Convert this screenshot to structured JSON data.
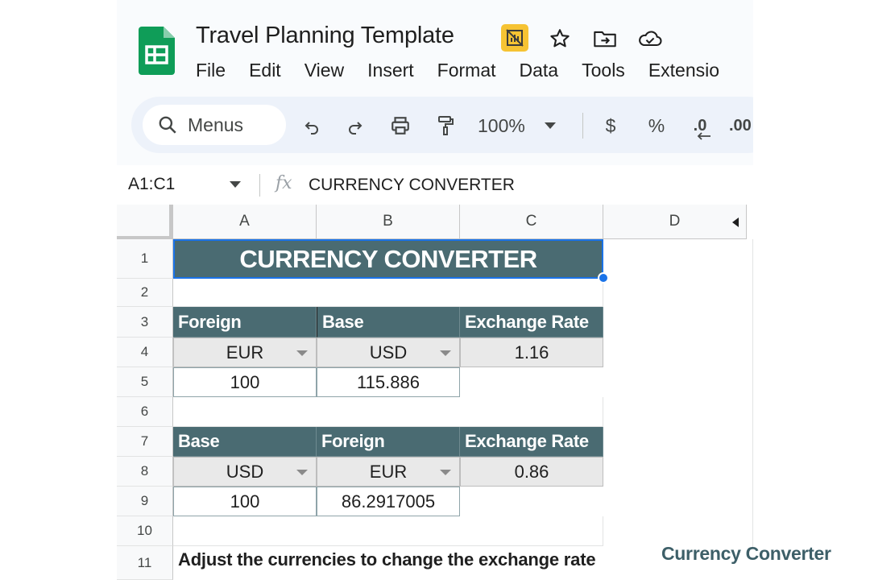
{
  "window": {
    "doc_title": "Travel Planning Template",
    "menu": [
      "File",
      "Edit",
      "View",
      "Insert",
      "Format",
      "Data",
      "Tools",
      "Extensio"
    ]
  },
  "toolbar": {
    "search_label": "Menus",
    "zoom": "100%",
    "currency_symbol": "$",
    "percent_symbol": "%",
    "decrease_decimal": ".0",
    "increase_decimal": ".00"
  },
  "formula_bar": {
    "name_box": "A1:C1",
    "fx": "fx",
    "content": "CURRENCY CONVERTER"
  },
  "columns": [
    "A",
    "B",
    "C",
    "D"
  ],
  "rows": [
    "1",
    "2",
    "3",
    "4",
    "5",
    "6",
    "7",
    "8",
    "9",
    "10",
    "11"
  ],
  "sheet": {
    "title": "CURRENCY CONVERTER",
    "table1": {
      "headers": [
        "Foreign",
        "Base",
        "Exchange Rate"
      ],
      "foreign_currency": "EUR",
      "base_currency": "USD",
      "rate": "1.16",
      "amount": "100",
      "converted": "115.886"
    },
    "table2": {
      "headers": [
        "Base",
        "Foreign",
        "Exchange Rate"
      ],
      "base_currency": "USD",
      "foreign_currency": "EUR",
      "rate": "0.86",
      "amount": "100",
      "converted": "86.2917005"
    },
    "note": "Adjust the currencies to change the exchange rate"
  },
  "overlay_caption": "Currency Converter",
  "colors": {
    "header_fill": "#4a6b72",
    "selection": "#1a73e8",
    "dropdown_fill": "#e9e9e9",
    "sheets_green": "#0f9d58",
    "badge_yellow": "#f6c333"
  }
}
